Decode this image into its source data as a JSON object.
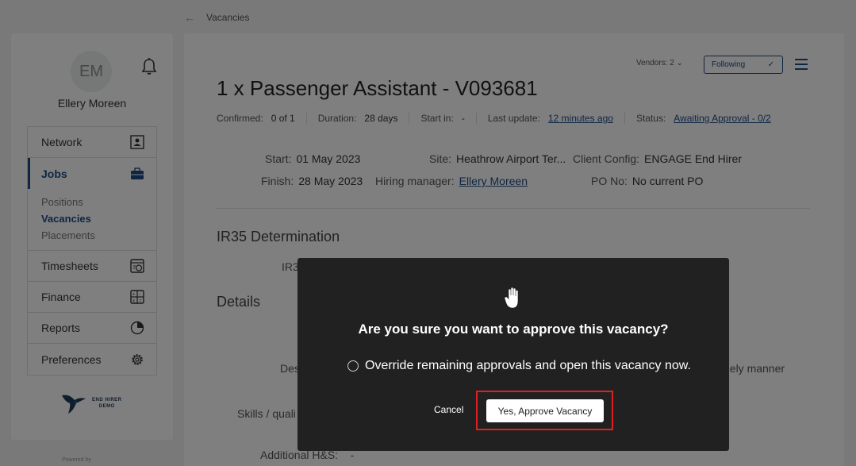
{
  "breadcrumb": {
    "label": "Vacancies"
  },
  "user": {
    "initials": "EM",
    "name": "Ellery Moreen"
  },
  "menu": {
    "network": "Network",
    "jobs": "Jobs",
    "jobs_sub": [
      "Positions",
      "Vacancies",
      "Placements"
    ],
    "timesheets": "Timesheets",
    "finance": "Finance",
    "reports": "Reports",
    "preferences": "Preferences"
  },
  "logo": {
    "line1": "END HIRER",
    "line2": "DEMO"
  },
  "footer": {
    "powered": "Powered by"
  },
  "header": {
    "vendors": "Vendors: 2",
    "following": "Following",
    "title": "1 x Passenger Assistant - V093681"
  },
  "meta": {
    "confirmed_label": "Confirmed:",
    "confirmed_value": "0 of 1",
    "duration_label": "Duration:",
    "duration_value": "28 days",
    "start_in_label": "Start in:",
    "start_in_value": "-",
    "last_update_label": "Last update:",
    "last_update_value": "12 minutes ago",
    "status_label": "Status:",
    "status_value": "Awaiting Approval - 0/2"
  },
  "info": {
    "start_label": "Start:",
    "start_value": "01 May 2023",
    "finish_label": "Finish:",
    "finish_value": "28 May 2023",
    "site_label": "Site:",
    "site_value": "Heathrow Airport Ter...",
    "hiring_label": "Hiring manager:",
    "hiring_value": "Ellery Moreen",
    "client_label": "Client Config:",
    "client_value": "ENGAGE End Hirer",
    "po_label": "PO No:",
    "po_value": "No current PO"
  },
  "sections": {
    "ir35": "IR35 Determination",
    "ir35_partial": "IR3",
    "details": "Details",
    "desc_partial": "Des",
    "desc_tail": "nely manner",
    "skills_partial": "Skills / quali",
    "additional": "Additional H&S:",
    "additional_value": "-"
  },
  "modal": {
    "title": "Are you sure you want to approve this vacancy?",
    "option": "Override remaining approvals and open this vacancy now.",
    "cancel": "Cancel",
    "approve": "Yes, Approve Vacancy"
  },
  "colors": {
    "accent": "#1f4c85",
    "highlight": "#e02020",
    "modal_bg": "#212121"
  }
}
